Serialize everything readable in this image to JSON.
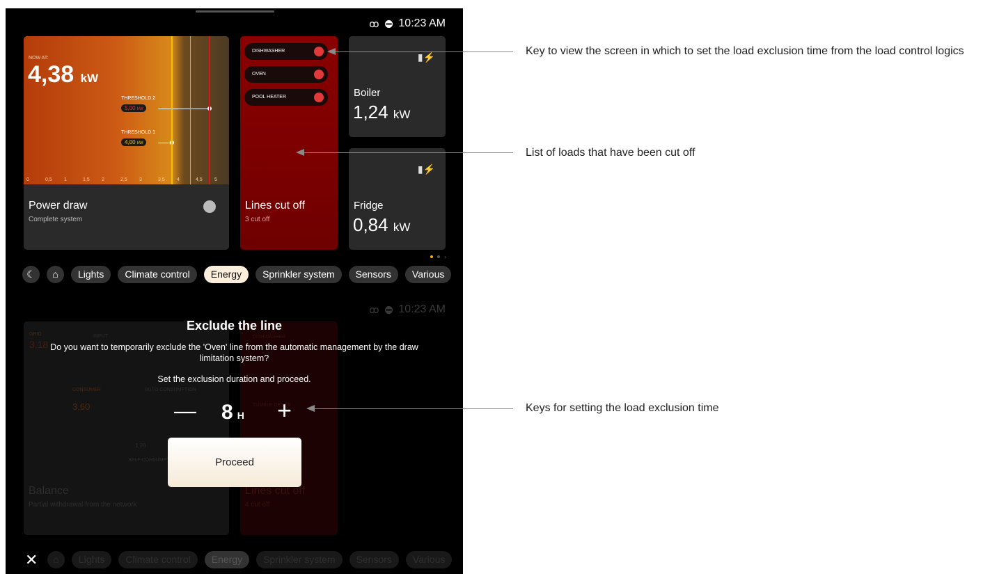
{
  "status": {
    "time": "10:23 AM"
  },
  "power": {
    "now_at": "NOW AT:",
    "value": "4,38",
    "unit": "kW",
    "threshold2_label": "THRESHOLD 2",
    "threshold2_value": "5,00",
    "threshold1_label": "THRESHOLD 1",
    "threshold1_value": "4,00",
    "threshold_unit": "kW",
    "axis": [
      "0",
      "0,5",
      "1",
      "1,5",
      "2",
      "2,5",
      "3",
      "3,5",
      "4",
      "4,5",
      "5"
    ],
    "title": "Power draw",
    "subtitle": "Complete system"
  },
  "lines_cut": {
    "loads": [
      "DISHWASHER",
      "OVEN",
      "POOL HEATER"
    ],
    "title": "Lines cut off",
    "subtitle": "3 cut off"
  },
  "boiler": {
    "name": "Boiler",
    "value": "1,24",
    "unit": "kW"
  },
  "fridge": {
    "name": "Fridge",
    "value": "0,84",
    "unit": "kW"
  },
  "chips": [
    "Lights",
    "Climate control",
    "Energy",
    "Sprinkler system",
    "Sensors",
    "Various"
  ],
  "bg": {
    "grid_label": "GRID",
    "grid_value": "3,18",
    "input_label": "INPUT",
    "dishwasher": "DISHWASHER",
    "tumble": "TUMBLE DRYER",
    "consumer_label": "CONSUMER",
    "consumer_value": "3,60",
    "auto_label": "AUTO CONSUMPTION",
    "small_value": "1,20",
    "self_label": "SELF CONSUMPTION",
    "balance_title": "Balance",
    "balance_sub": "Partial withdrawal from the network",
    "lines_title": "Lines cut off",
    "lines_sub": "4 cut off"
  },
  "modal": {
    "title": "Exclude the line",
    "text": "Do you want to temporarily exclude the 'Oven' line from the automatic management by the draw limitation system?",
    "text2": "Set the exclusion duration and proceed.",
    "minus": "—",
    "plus": "+",
    "hours": "8",
    "hours_unit": "H",
    "proceed": "Proceed",
    "close": "✕"
  },
  "annotations": {
    "a1": "Key to view the screen in which to set the load exclusion time from the load control logics",
    "a2": "List of loads that have been cut off",
    "a3": "Keys for setting the load exclusion time"
  }
}
